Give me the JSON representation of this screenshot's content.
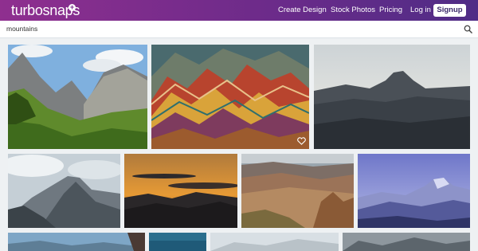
{
  "brand": {
    "name": "turbosnaps",
    "badge": "+"
  },
  "nav": {
    "create_design": "Create Design",
    "stock_photos": "Stock Photos",
    "pricing": "Pricing",
    "login": "Log in",
    "signup": "Signup"
  },
  "search": {
    "value": "mountains"
  },
  "colors": {
    "brand_gradient_start": "#8f2f8f",
    "brand_gradient_end": "#4f2c86",
    "background": "#eef1f3"
  },
  "icons": {
    "search": "search-icon",
    "favorite": "heart-icon",
    "logo_badge": "plus-icon"
  }
}
